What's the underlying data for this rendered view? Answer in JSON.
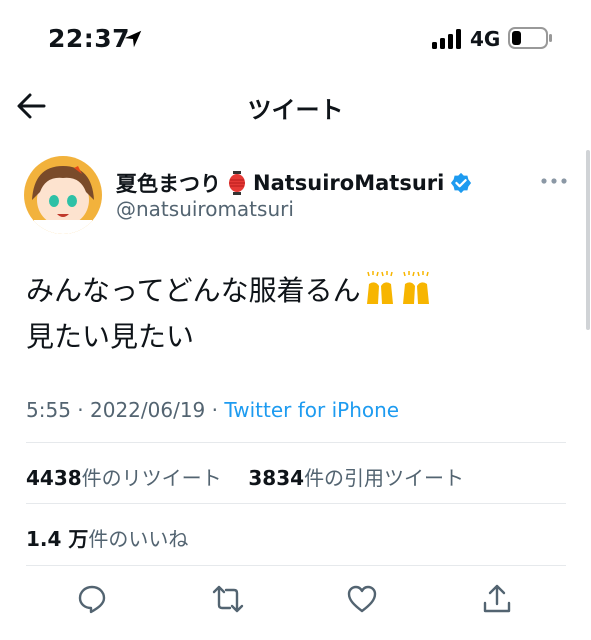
{
  "status_bar": {
    "time": "22:37",
    "network": "4G"
  },
  "nav": {
    "title": "ツイート"
  },
  "user": {
    "display_name_jp": "夏色まつり",
    "display_name_en": "NatsuiroMatsuri",
    "handle": "@natsuiromatsuri"
  },
  "tweet": {
    "line1": "みんなってどんな服着るん",
    "line2": "見たい見たい",
    "time": "5:55",
    "date": "2022/06/19",
    "source": "Twitter for iPhone"
  },
  "stats": {
    "retweets": "4438",
    "retweets_label": "件のリツイート",
    "quotes": "3834",
    "quotes_label": "件の引用ツイート",
    "likes": "1.4 万",
    "likes_label": "件のいいね"
  },
  "colors": {
    "accent": "#1d9bf0",
    "secondary_text": "#536471",
    "divider": "#e6e9ec"
  },
  "icons": [
    "location-arrow-icon",
    "signal-icon",
    "battery-icon",
    "back-arrow-icon",
    "lantern-emoji",
    "verified-badge-icon",
    "more-icon",
    "raised-hands-emoji",
    "reply-icon",
    "retweet-icon",
    "like-icon",
    "share-icon"
  ]
}
